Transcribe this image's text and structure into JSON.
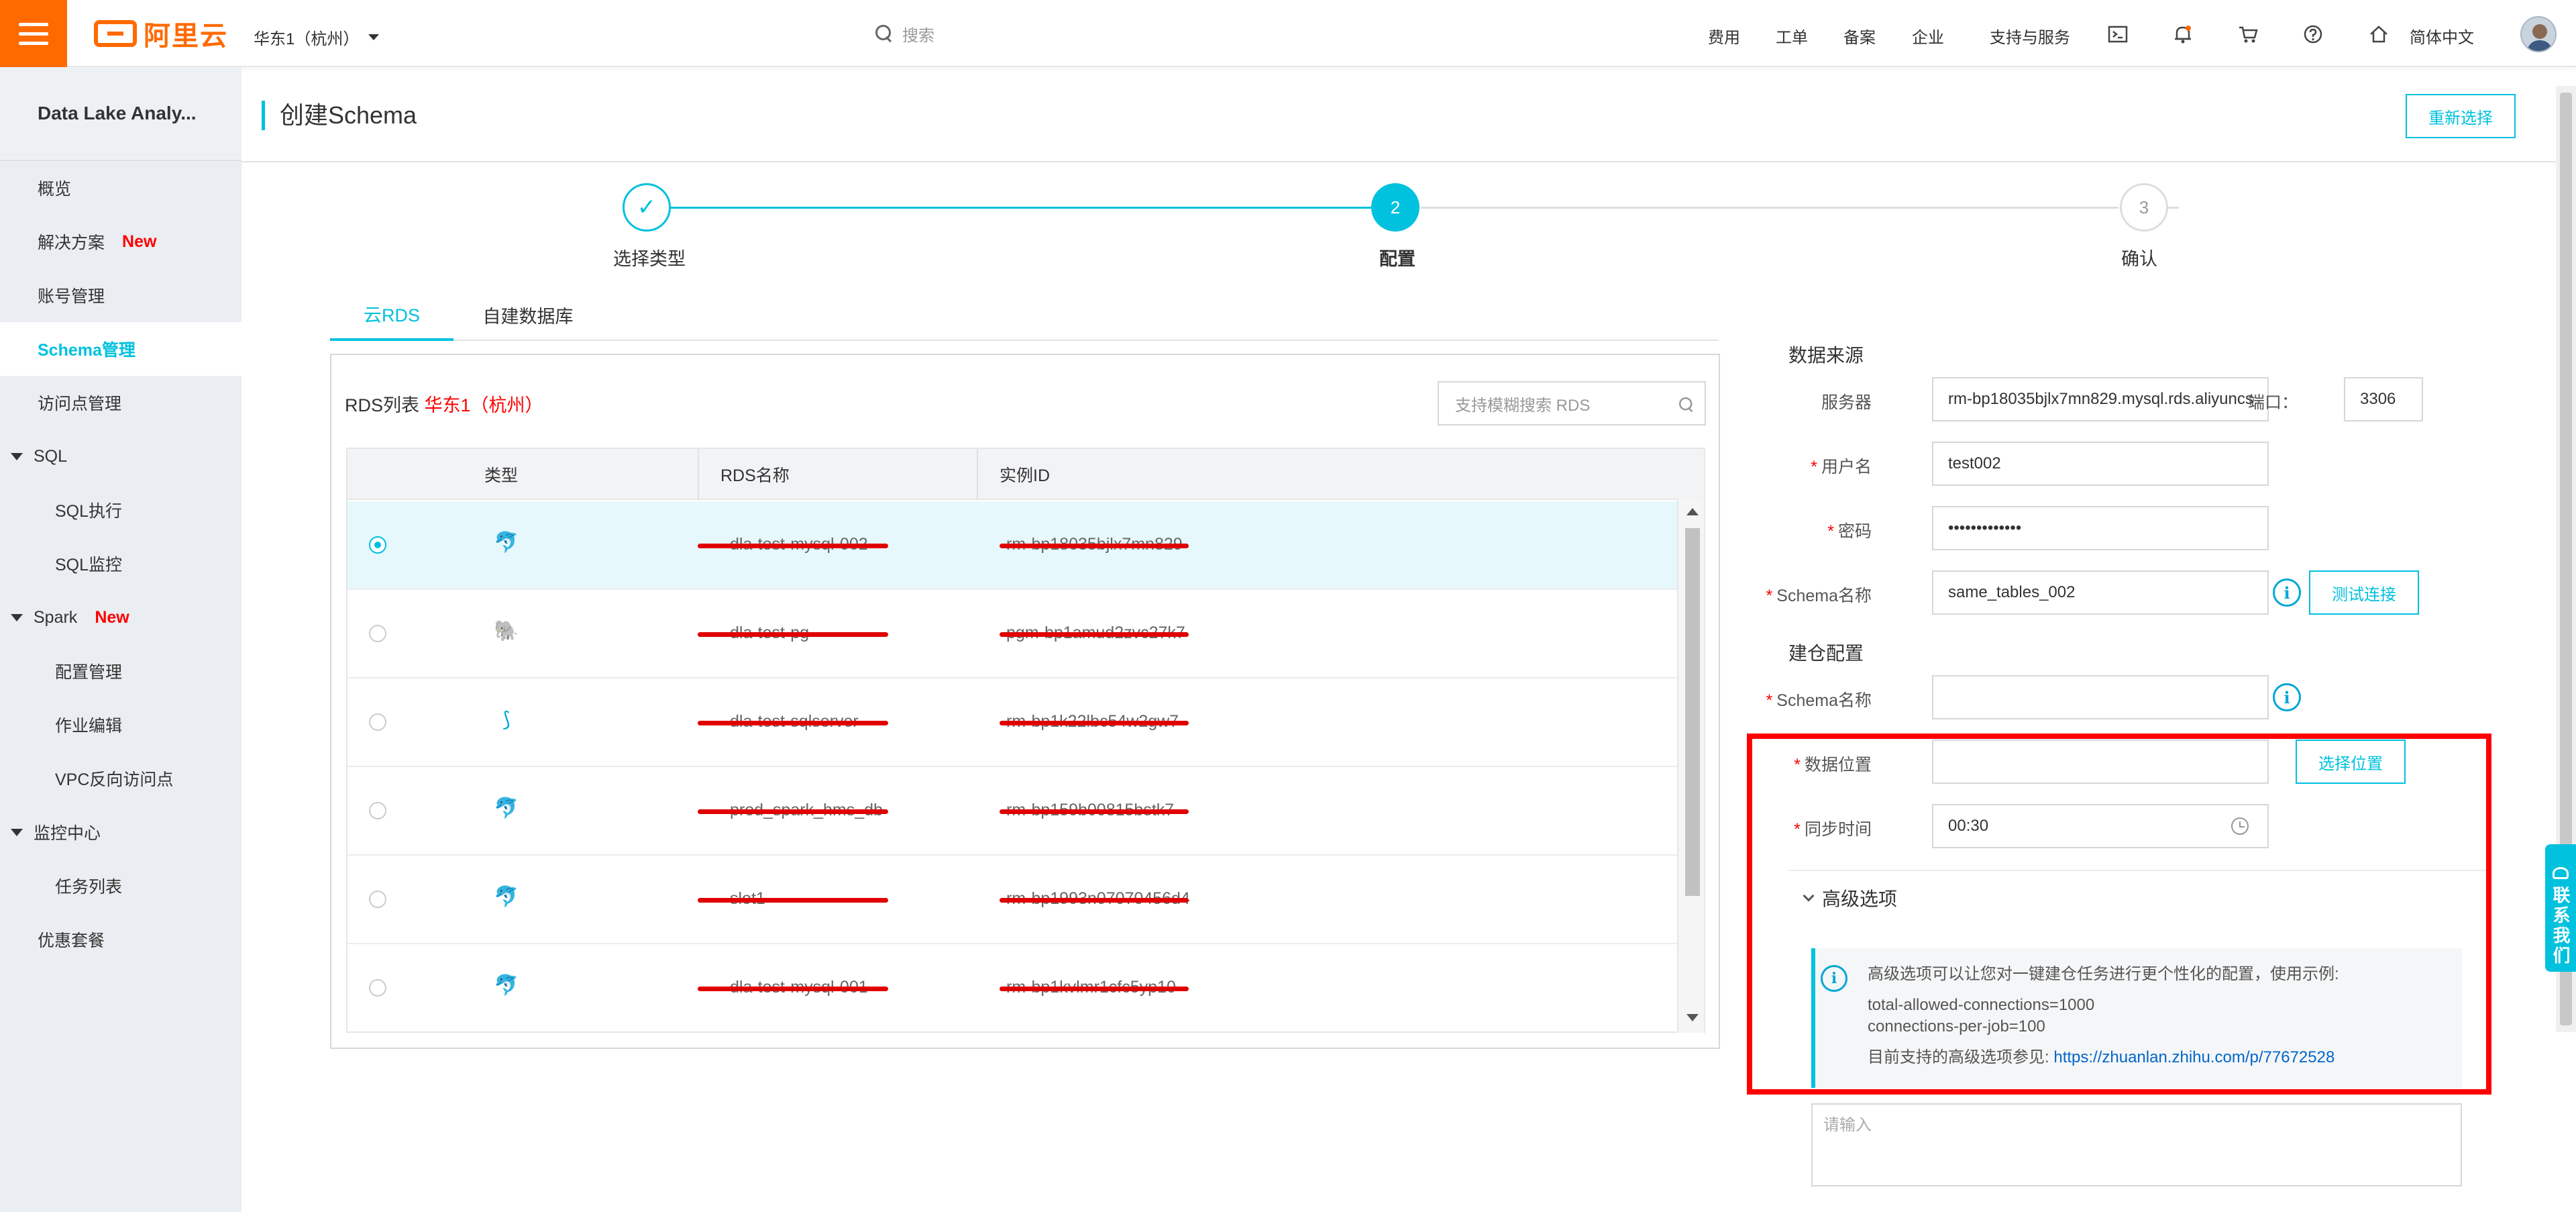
{
  "topbar": {
    "logo_text": "阿里云",
    "region": "华东1（杭州）",
    "search_placeholder": "搜索",
    "nav": [
      "费用",
      "工单",
      "备案",
      "企业",
      "支持与服务"
    ],
    "icons": [
      "terminal-icon",
      "bell-icon",
      "cart-icon",
      "help-icon",
      "home-icon"
    ],
    "language": "简体中文"
  },
  "sidebar": {
    "title": "Data Lake Analy...",
    "items": [
      {
        "label": "概览"
      },
      {
        "label": "解决方案",
        "badge": "New"
      },
      {
        "label": "账号管理"
      },
      {
        "label": "Schema管理"
      },
      {
        "label": "访问点管理"
      },
      {
        "label": "SQL"
      },
      {
        "label": "SQL执行"
      },
      {
        "label": "SQL监控"
      },
      {
        "label": "Spark",
        "badge": "New"
      },
      {
        "label": "配置管理"
      },
      {
        "label": "作业编辑"
      },
      {
        "label": "VPC反向访问点"
      },
      {
        "label": "监控中心"
      },
      {
        "label": "任务列表"
      },
      {
        "label": "优惠套餐"
      }
    ]
  },
  "page": {
    "title": "创建Schema",
    "reselect_label": "重新选择"
  },
  "steps": [
    {
      "label": "选择类型",
      "marker": "✓"
    },
    {
      "label": "配置",
      "marker": "2"
    },
    {
      "label": "确认",
      "marker": "3"
    }
  ],
  "tabs": [
    "云RDS",
    "自建数据库"
  ],
  "rds": {
    "list_title": "RDS列表",
    "region": "华东1（杭州）",
    "search_placeholder": "支持模糊搜索 RDS",
    "columns": [
      "类型",
      "RDS名称",
      "实例ID"
    ],
    "rows": [
      {
        "icon": "mysql-icon",
        "name": "dla-test-mysql-002",
        "id": "rm-bp18035bjlx7mn829"
      },
      {
        "icon": "postgresql-icon",
        "name": "dla-test-pg",
        "id": "pgm-bp1amud2zvc27k7"
      },
      {
        "icon": "sqlserver-icon",
        "name": "dla-test-sqlserver",
        "id": "rm-bp1k22lbc54w2gw7"
      },
      {
        "icon": "mysql-icon",
        "name": "prod_spark_hms_db",
        "id": "rm-bp159b00815bstk7"
      },
      {
        "icon": "mysql-icon",
        "name": "slot1",
        "id": "rm-bp1993n07070456d4"
      },
      {
        "icon": "mysql-icon",
        "name": "dla-test-mysql-001",
        "id": "rm-bp1kvlmr1cfc5yp10"
      }
    ]
  },
  "form": {
    "source_title": "数据来源",
    "server_label": "服务器",
    "server_value": "rm-bp18035bjlx7mn829.mysql.rds.aliyuncs",
    "port_label": "端口：",
    "port_value": "3306",
    "username_label": "用户名",
    "username_value": "test002",
    "password_label": "密码",
    "password_value": "•••••••••••••",
    "schema_label": "Schema名称",
    "schema_value": "same_tables_002",
    "test_btn": "测试连接",
    "warehouse_title": "建仓配置",
    "wh_schema_label": "Schema名称",
    "wh_schema_value": "",
    "location_label": "数据位置",
    "location_value": "",
    "select_location_btn": "选择位置",
    "sync_label": "同步时间",
    "sync_value": "00:30",
    "advanced_label": "高级选项",
    "advanced_desc": "高级选项可以让您对一键建仓任务进行更个性化的配置，使用示例:",
    "advanced_ex1": "total-allowed-connections=1000",
    "advanced_ex2": "connections-per-job=100",
    "advanced_ref": "目前支持的高级选项参见:",
    "advanced_link": "https://zhuanlan.zhihu.com/p/77672528",
    "textarea_placeholder": "请输入"
  },
  "contact": "联系我们",
  "colors": {
    "brand": "#ff6a00",
    "accent": "#00c1de",
    "highlight": "#ff0000"
  }
}
